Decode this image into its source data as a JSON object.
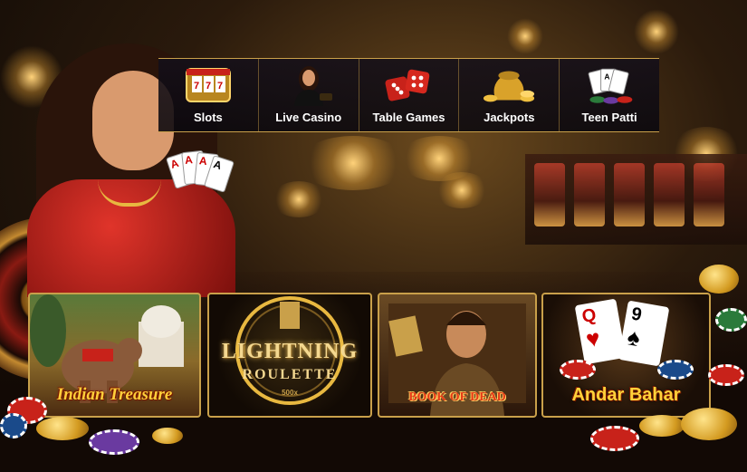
{
  "nav": {
    "items": [
      {
        "label": "Slots",
        "icon": "slot-machine-icon"
      },
      {
        "label": "Live Casino",
        "icon": "live-dealer-icon"
      },
      {
        "label": "Table Games",
        "icon": "dice-icon"
      },
      {
        "label": "Jackpots",
        "icon": "gold-coins-icon"
      },
      {
        "label": "Teen Patti",
        "icon": "playing-cards-icon"
      }
    ]
  },
  "games": [
    {
      "title": "Indian Treasure"
    },
    {
      "title_line1": "LIGHTNING",
      "title_line2": "ROULETTE",
      "multiplier": "500x"
    },
    {
      "title": "BOOK OF DEAD"
    },
    {
      "title": "Andar Bahar",
      "card_left": "Q",
      "card_right": "9"
    }
  ],
  "hand_cards": [
    "A",
    "A",
    "A",
    "A"
  ],
  "colors": {
    "gold": "#c9a04a",
    "dress_red": "#c8221a",
    "nav_bg": "#14101a"
  }
}
